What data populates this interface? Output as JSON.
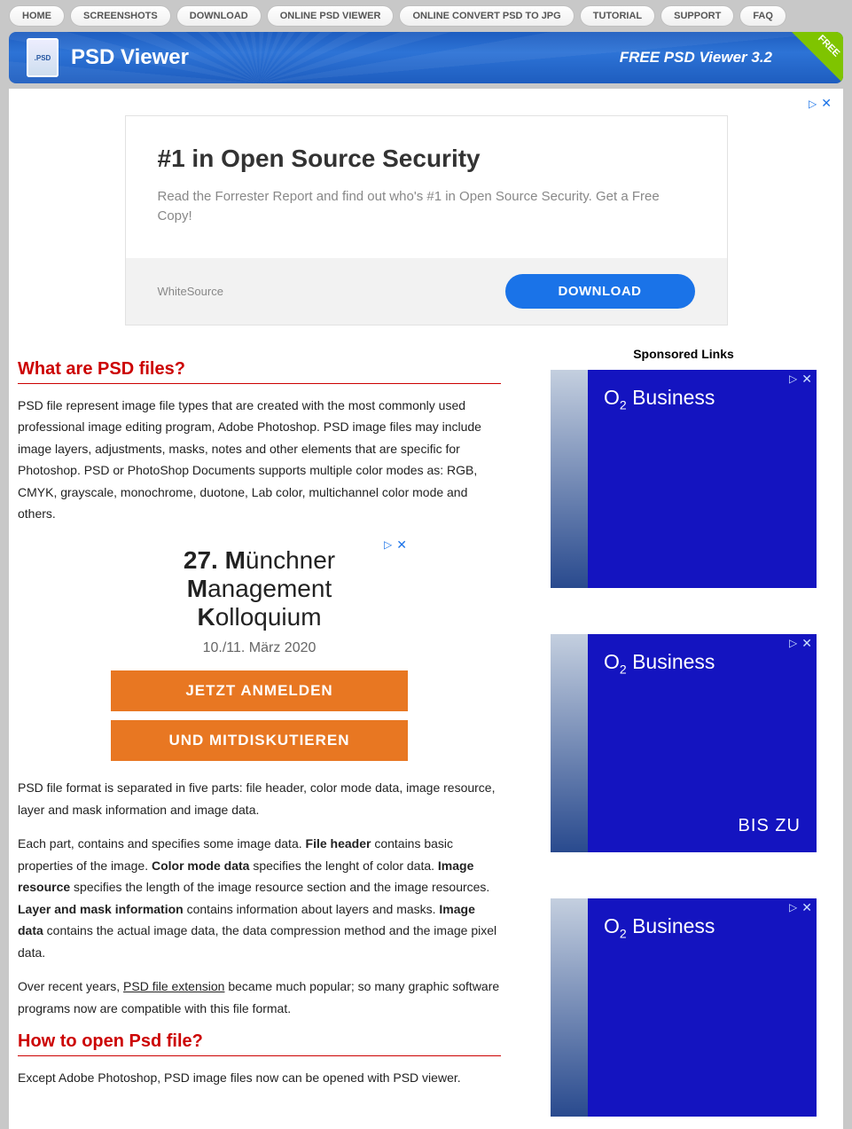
{
  "nav": [
    "HOME",
    "SCREENSHOTS",
    "DOWNLOAD",
    "ONLINE PSD VIEWER",
    "ONLINE CONVERT PSD TO JPG",
    "TUTORIAL",
    "SUPPORT",
    "FAQ"
  ],
  "banner": {
    "title": "PSD Viewer",
    "tagline": "FREE PSD Viewer 3.2",
    "corner": "FREE",
    "logo_badge": ".PSD"
  },
  "top_ad": {
    "title": "#1 in Open Source Security",
    "body": "Read the Forrester Report and find out who's #1 in Open Source Security. Get a Free Copy!",
    "sponsor": "WhiteSource",
    "button": "DOWNLOAD",
    "marker": "▷",
    "close": "✕"
  },
  "article": {
    "h1": "What are PSD files?",
    "p1": "PSD file represent image file types that are created with the most commonly used professional image editing program, Adobe Photoshop. PSD image files may include image layers, adjustments, masks, notes and other elements that are specific for Photoshop. PSD or PhotoShop Documents supports multiple color modes as: RGB, CMYK, grayscale, monochrome, duotone, Lab color, multichannel color mode and others.",
    "p2": "PSD file format is separated in five parts: file header, color mode data, image resource, layer and mask information and image data.",
    "p3_a": "Each part, contains and specifies some image data. ",
    "p3_b1": "File header",
    "p3_c": " contains basic properties of the image. ",
    "p3_b2": "Color mode data",
    "p3_d": " specifies the lenght of color data. ",
    "p3_b3": "Image resource",
    "p3_e": " specifies the length of the image resource section and the image resources. ",
    "p3_b4": "Layer and mask information",
    "p3_f": " contains information about layers and masks. ",
    "p3_b5": "Image data",
    "p3_g": " contains the actual image data, the data compression method and the image pixel data.",
    "p4_a": "Over recent years, ",
    "p4_link": "PSD file extension",
    "p4_b": " became much popular; so many graphic software programs now are compatible with this file format.",
    "h2": "How to open Psd file?",
    "p5": "Except Adobe Photoshop, PSD image files now can be opened with PSD viewer."
  },
  "inline_ad": {
    "prefix": "27.",
    "l1": "Münchner",
    "l2": "Management",
    "l3": "Kolloquium",
    "date": "10./11. März 2020",
    "btn1": "JETZT ANMELDEN",
    "btn2": "UND MITDISKUTIEREN",
    "marker": "▷",
    "close": "✕"
  },
  "sidebar": {
    "title": "Sponsored Links",
    "ads": [
      {
        "brand_pre": "O",
        "brand_sub": "2",
        "brand_post": " Business",
        "extra": ""
      },
      {
        "brand_pre": "O",
        "brand_sub": "2",
        "brand_post": " Business",
        "extra": "BIS ZU"
      },
      {
        "brand_pre": "O",
        "brand_sub": "2",
        "brand_post": " Business",
        "extra": ""
      }
    ],
    "marker": "▷",
    "close": "✕"
  }
}
